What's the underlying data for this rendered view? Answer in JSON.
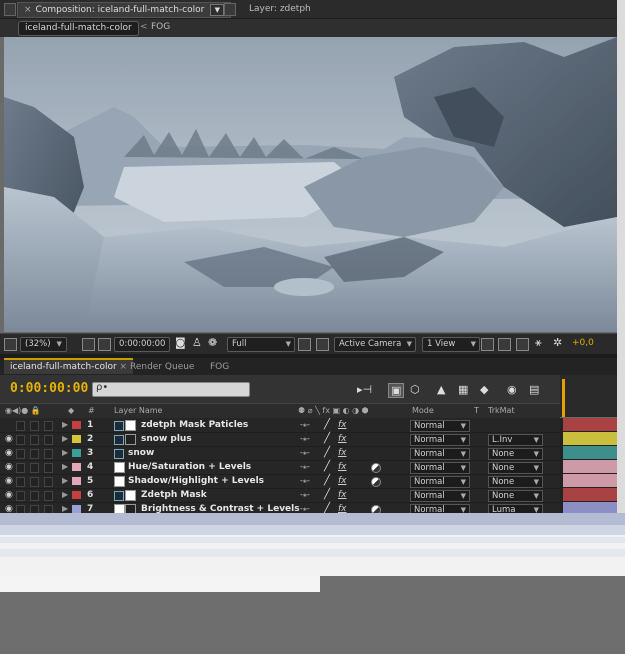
{
  "comp_tabs": {
    "comp_label": "Composition: iceland-full-match-color",
    "layer_label": "Layer: zdetph"
  },
  "breadcrumb": {
    "current": "iceland-full-match-color",
    "separator": "<",
    "next": "FOG"
  },
  "viewer_toolbar": {
    "zoom": "(32%)",
    "timecode": "0:00:00:00",
    "resolution": "Full",
    "camera": "Active Camera",
    "views": "1 View",
    "exposure": "+0,0"
  },
  "timeline_tabs": [
    "iceland-full-match-color",
    "Render Queue",
    "FOG"
  ],
  "timeline": {
    "current_time": "0:00:00:00",
    "search_placeholder": "ρ•",
    "headers": {
      "num": "#",
      "layer_name": "Layer Name",
      "mode": "Mode",
      "t": "T",
      "trkmat": "TrkMat"
    },
    "layers": [
      {
        "num": "1",
        "name": "zdetph Mask Paticles",
        "mode": "Normal",
        "trkmat": "",
        "label_color": "#c44040",
        "bar_color": "#a94343"
      },
      {
        "num": "2",
        "name": "snow plus",
        "mode": "Normal",
        "trkmat": "L.Inv",
        "label_color": "#d4c53a",
        "bar_color": "#c9bf3c"
      },
      {
        "num": "3",
        "name": "snow",
        "mode": "Normal",
        "trkmat": "None",
        "label_color": "#3a9f99",
        "bar_color": "#3e8e8b"
      },
      {
        "num": "4",
        "name": "Hue/Saturation + Levels",
        "mode": "Normal",
        "trkmat": "None",
        "label_color": "#e0a8b8",
        "bar_color": "#cf9aa8"
      },
      {
        "num": "5",
        "name": "Shadow/Highlight + Levels",
        "mode": "Normal",
        "trkmat": "None",
        "label_color": "#e0a8b8",
        "bar_color": "#cf9aa8"
      },
      {
        "num": "6",
        "name": "Zdetph Mask",
        "mode": "Normal",
        "trkmat": "None",
        "label_color": "#c44040",
        "bar_color": "#a94343"
      },
      {
        "num": "7",
        "name": "Brightness & Contrast + Levels",
        "mode": "Normal",
        "trkmat": "Luma",
        "label_color": "#9aa0d8",
        "bar_color": "#8c8fc4"
      }
    ]
  },
  "colors": {
    "accent": "#e8b300",
    "panel": "#2b2b2b"
  }
}
